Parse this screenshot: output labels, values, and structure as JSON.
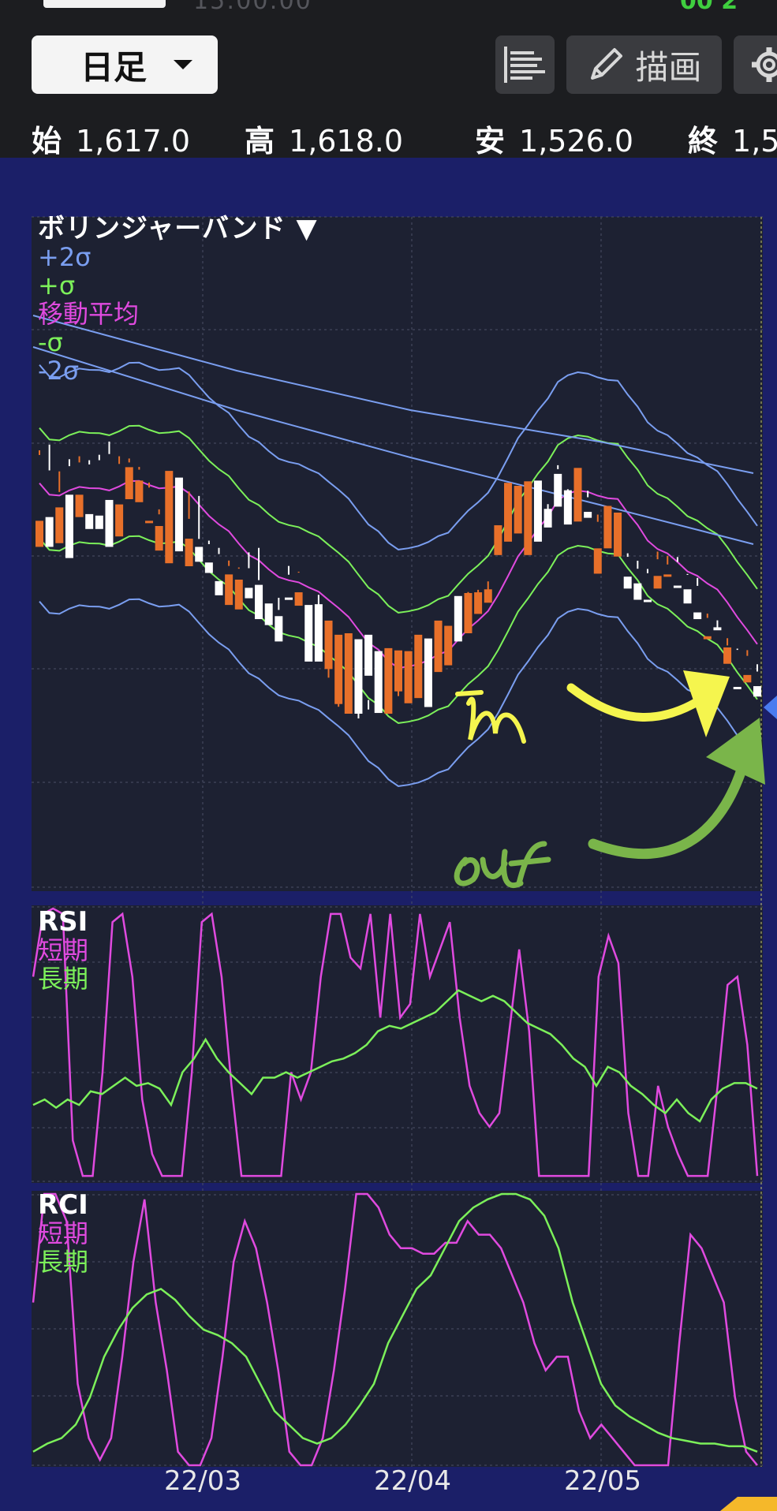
{
  "status": {
    "time_fragment": "15:00:00",
    "right_fragment": "00  2"
  },
  "toolbar": {
    "period": "日足",
    "draw_label": "描画",
    "list_icon": "list-icon",
    "pencil_icon": "pencil-icon",
    "gear_icon": "gear-icon"
  },
  "ohlc": {
    "open_label": "始",
    "open": "1,617.0",
    "high_label": "高",
    "high": "1,618.0",
    "low_label": "安",
    "low": "1,526.0",
    "close_label": "終",
    "close": "1,5"
  },
  "colors": {
    "up": "#e8702a",
    "down": "#ffffff",
    "band2": "#7a9ef0",
    "band1": "#7cf05a",
    "ma": "#e04adf",
    "rsi_short": "#e04adf",
    "rsi_long": "#7cf05a",
    "annotation_yellow": "#f5f54e",
    "annotation_green": "#7ab54a",
    "marker": "#4a7cf0"
  },
  "legends": {
    "bb": {
      "title": "ボリンジャーバンド ▼",
      "plus2": "+2σ",
      "plus1": "+σ",
      "ma": "移動平均",
      "minus1": "-σ",
      "minus2": "-2σ"
    },
    "rsi": {
      "title": "RSI",
      "short": "短期",
      "long": "長期"
    },
    "rci": {
      "title": "RCI",
      "short": "短期",
      "long": "長期"
    }
  },
  "x_axis": [
    "22/03",
    "22/04",
    "22/05"
  ],
  "annotations": {
    "yellow_text": "-m",
    "green_text": "Out"
  },
  "chart_data": [
    {
      "type": "candlestick",
      "title": "ボリンジャーバンド",
      "series_names": [
        "+2σ",
        "+σ",
        "移動平均",
        "-σ",
        "-2σ"
      ],
      "candles": [
        [
          1,
          563,
          544,
          680,
          645
        ],
        [
          0,
          549,
          571,
          640,
          680
        ],
        [
          1,
          585,
          600,
          675,
          627
        ],
        [
          0,
          578,
          556,
          695,
          610
        ],
        [
          1,
          573,
          552,
          640,
          610
        ],
        [
          0,
          570,
          563,
          636,
          656
        ],
        [
          0,
          570,
          550,
          638,
          656
        ],
        [
          0,
          545,
          549,
          617,
          680
        ],
        [
          1,
          575,
          552,
          666,
          623
        ],
        [
          1,
          573,
          555,
          616,
          573
        ],
        [
          1,
          579,
          570,
          620,
          591
        ],
        [
          1,
          600,
          594,
          647,
          645
        ],
        [
          1,
          636,
          630,
          685,
          652
        ],
        [
          1,
          659,
          615,
          702,
          578
        ],
        [
          0,
          628,
          617,
          686,
          587
        ],
        [
          1,
          612,
          636,
          706,
          669
        ],
        [
          0,
          618,
          663,
          700,
          680
        ],
        [
          0,
          678,
          670,
          715,
          701
        ],
        [
          0,
          696,
          675,
          745,
          726
        ],
        [
          1,
          712,
          692,
          758,
          717
        ],
        [
          1,
          714,
          703,
          764,
          724
        ],
        [
          0,
          715,
          681,
          749,
          735
        ],
        [
          0,
          731,
          675,
          777,
          731
        ],
        [
          0,
          765,
          757,
          785,
          756
        ],
        [
          0,
          771,
          742,
          807,
          773
        ],
        [
          0,
          712,
          711,
          748,
          751
        ],
        [
          1,
          721,
          707,
          759,
          741
        ],
        [
          0,
          789,
          764,
          834,
          758
        ],
        [
          0,
          810,
          738,
          834,
          757
        ],
        [
          1,
          862,
          785,
          844,
          779
        ],
        [
          1,
          901,
          866,
          891,
          798
        ],
        [
          1,
          896,
          885,
          904,
          796
        ],
        [
          0,
          904,
          904,
          904,
          804
        ],
        [
          0,
          892,
          892,
          853,
          798
        ],
        [
          0,
          899,
          831,
          903,
          820
        ],
        [
          1,
          900,
          892,
          904,
          816
        ],
        [
          1,
          858,
          874,
          874,
          819
        ],
        [
          1,
          850,
          819,
          890,
          820
        ],
        [
          1,
          843,
          840,
          883,
          798
        ],
        [
          0,
          838,
          831,
          895,
          803
        ],
        [
          1,
          836,
          799,
          848,
          779
        ],
        [
          1,
          811,
          801,
          839,
          786
        ],
        [
          0,
          772,
          751,
          807,
          746
        ],
        [
          1,
          747,
          748,
          796,
          742
        ],
        [
          1,
          744,
          741,
          770,
          741
        ],
        [
          1,
          747,
          720,
          755,
          737
        ],
        [
          1,
          659,
          681,
          691,
          651
        ],
        [
          1,
          663,
          631,
          673,
          594
        ],
        [
          1,
          649,
          617,
          662,
          598
        ],
        [
          1,
          679,
          659,
          691,
          592
        ],
        [
          0,
          637,
          629,
          673,
          591
        ],
        [
          0,
          629,
          626,
          654,
          629
        ],
        [
          0,
          582,
          564,
          626,
          582
        ],
        [
          0,
          609,
          602,
          650,
          604
        ],
        [
          1,
          621,
          594,
          646,
          574
        ],
        [
          0,
          611,
          607,
          641,
          633
        ],
        [
          1,
          643,
          640,
          716,
          682
        ],
        [
          1,
          648,
          642,
          682,
          625
        ],
        [
          1,
          648,
          637,
          693,
          634
        ],
        [
          0,
          695,
          687,
          736,
          720
        ],
        [
          0,
          705,
          703,
          751,
          729
        ],
        [
          0,
          716,
          709,
          751,
          754
        ],
        [
          1,
          703,
          680,
          736,
          719
        ],
        [
          1,
          710,
          686,
          717,
          720
        ],
        [
          0,
          700,
          694,
          734,
          732
        ],
        [
          0,
          724,
          710,
          756,
          737
        ],
        [
          0,
          728,
          726,
          777,
          768
        ],
        [
          1,
          776,
          769,
          800,
          804
        ],
        [
          0,
          785,
          784,
          788,
          792
        ],
        [
          1,
          809,
          806,
          815,
          837
        ],
        [
          0,
          823,
          812,
          868,
          870
        ],
        [
          1,
          825,
          820,
          862,
          852
        ],
        [
          0,
          844,
          841,
          881,
          867
        ]
      ],
      "price_range": [
        1526.0,
        1618.0
      ]
    },
    {
      "type": "line",
      "title": "RSI",
      "series": [
        {
          "name": "短期"
        },
        {
          "name": "長期"
        }
      ],
      "short": [
        75,
        98,
        100,
        98,
        15,
        2,
        2,
        40,
        95,
        98,
        75,
        30,
        10,
        2,
        2,
        2,
        40,
        95,
        98,
        75,
        35,
        2,
        2,
        2,
        2,
        2,
        40,
        30,
        40,
        75,
        98,
        98,
        82,
        78,
        98,
        60,
        98,
        60,
        65,
        98,
        75,
        85,
        95,
        60,
        35,
        25,
        20,
        25,
        55,
        85,
        55,
        2,
        2,
        2,
        2,
        2,
        2,
        75,
        90,
        80,
        25,
        2,
        2,
        35,
        20,
        10,
        2,
        2,
        2,
        35,
        72,
        75,
        50,
        2
      ],
      "long": [
        28,
        30,
        27,
        30,
        28,
        33,
        32,
        35,
        38,
        35,
        36,
        34,
        28,
        40,
        45,
        52,
        45,
        40,
        36,
        32,
        38,
        38,
        40,
        38,
        40,
        42,
        44,
        45,
        47,
        50,
        55,
        57,
        56,
        58,
        60,
        62,
        66,
        70,
        68,
        66,
        68,
        66,
        62,
        58,
        56,
        54,
        50,
        45,
        42,
        35,
        42,
        40,
        35,
        32,
        28,
        25,
        30,
        25,
        22,
        30,
        34,
        36,
        36,
        34
      ]
    },
    {
      "type": "line",
      "title": "RCI",
      "series": [
        {
          "name": "短期"
        },
        {
          "name": "長期"
        }
      ],
      "short": [
        60,
        100,
        100,
        90,
        30,
        10,
        2,
        10,
        40,
        75,
        98,
        60,
        35,
        5,
        0,
        0,
        10,
        40,
        75,
        90,
        80,
        60,
        35,
        5,
        0,
        0,
        10,
        35,
        65,
        100,
        100,
        95,
        85,
        80,
        80,
        78,
        78,
        82,
        82,
        90,
        85,
        85,
        80,
        70,
        60,
        45,
        35,
        40,
        40,
        20,
        10,
        15,
        10,
        5,
        0,
        0,
        0,
        0,
        45,
        85,
        80,
        70,
        60,
        25,
        5,
        0
      ],
      "long": [
        5,
        8,
        10,
        15,
        25,
        40,
        50,
        58,
        63,
        65,
        61,
        55,
        50,
        48,
        45,
        40,
        30,
        20,
        15,
        10,
        8,
        10,
        15,
        22,
        30,
        45,
        55,
        65,
        70,
        80,
        90,
        95,
        98,
        100,
        100,
        98,
        92,
        80,
        60,
        45,
        30,
        22,
        18,
        15,
        12,
        10,
        9,
        8,
        8,
        7,
        7,
        5
      ]
    }
  ]
}
